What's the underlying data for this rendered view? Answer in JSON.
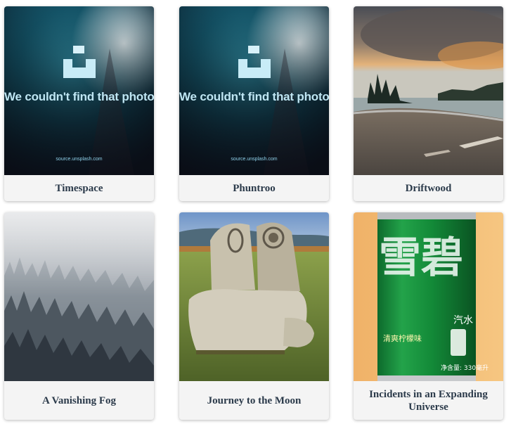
{
  "cards": [
    {
      "title": "Timespace",
      "image": {
        "kind": "placeholder",
        "message": "We couldn't find that photo",
        "source": "source.unsplash.com"
      }
    },
    {
      "title": "Phuntroo",
      "image": {
        "kind": "placeholder",
        "message": "We couldn't find that photo",
        "source": "source.unsplash.com"
      }
    },
    {
      "title": "Driftwood"
    },
    {
      "title": "A Vanishing Fog"
    },
    {
      "title": "Journey to the Moon"
    },
    {
      "title": "Incidents in an Expanding Universe",
      "image": {
        "can_brand": "雪碧",
        "can_flavor": "清爽柠檬味",
        "can_side": "汽水",
        "can_volume": "净含量: 330毫升"
      }
    }
  ],
  "colors": {
    "caption_text": "#2b3a4a",
    "card_bg": "#f4f4f4",
    "placeholder_accent": "#bfe6f3"
  }
}
